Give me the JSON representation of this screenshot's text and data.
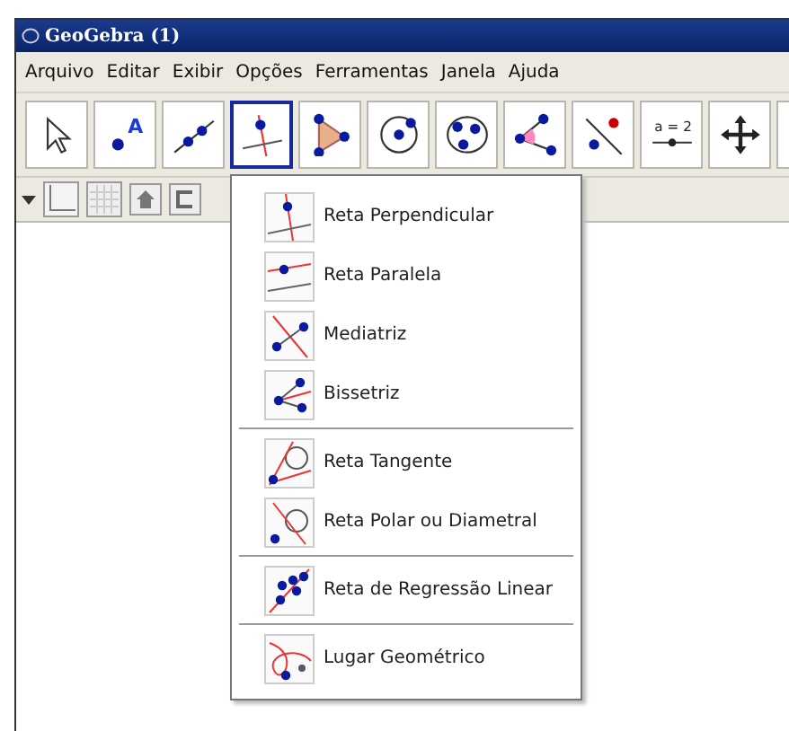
{
  "window": {
    "title": "GeoGebra (1)"
  },
  "menu_bar": [
    "Arquivo",
    "Editar",
    "Exibir",
    "Opções",
    "Ferramentas",
    "Janela",
    "Ajuda"
  ],
  "toolbar": [
    {
      "selected": false
    },
    {
      "selected": false,
      "icon_text": "A"
    },
    {
      "selected": false
    },
    {
      "selected": true
    },
    {
      "selected": false
    },
    {
      "selected": false
    },
    {
      "selected": false
    },
    {
      "selected": false
    },
    {
      "selected": false
    },
    {
      "selected": false,
      "icon_text": "a = 2"
    },
    {
      "selected": false
    },
    {
      "selected": false
    }
  ],
  "tool_menu": {
    "groups": [
      {
        "items": [
          {
            "label": "Reta Perpendicular"
          },
          {
            "label": "Reta Paralela"
          },
          {
            "label": "Mediatriz"
          },
          {
            "label": "Bissetriz"
          }
        ]
      },
      {
        "items": [
          {
            "label": "Reta Tangente"
          },
          {
            "label": "Reta Polar ou Diametral"
          }
        ]
      },
      {
        "items": [
          {
            "label": "Reta de Regressão Linear"
          }
        ]
      },
      {
        "items": [
          {
            "label": "Lugar Geométrico"
          }
        ]
      }
    ]
  }
}
